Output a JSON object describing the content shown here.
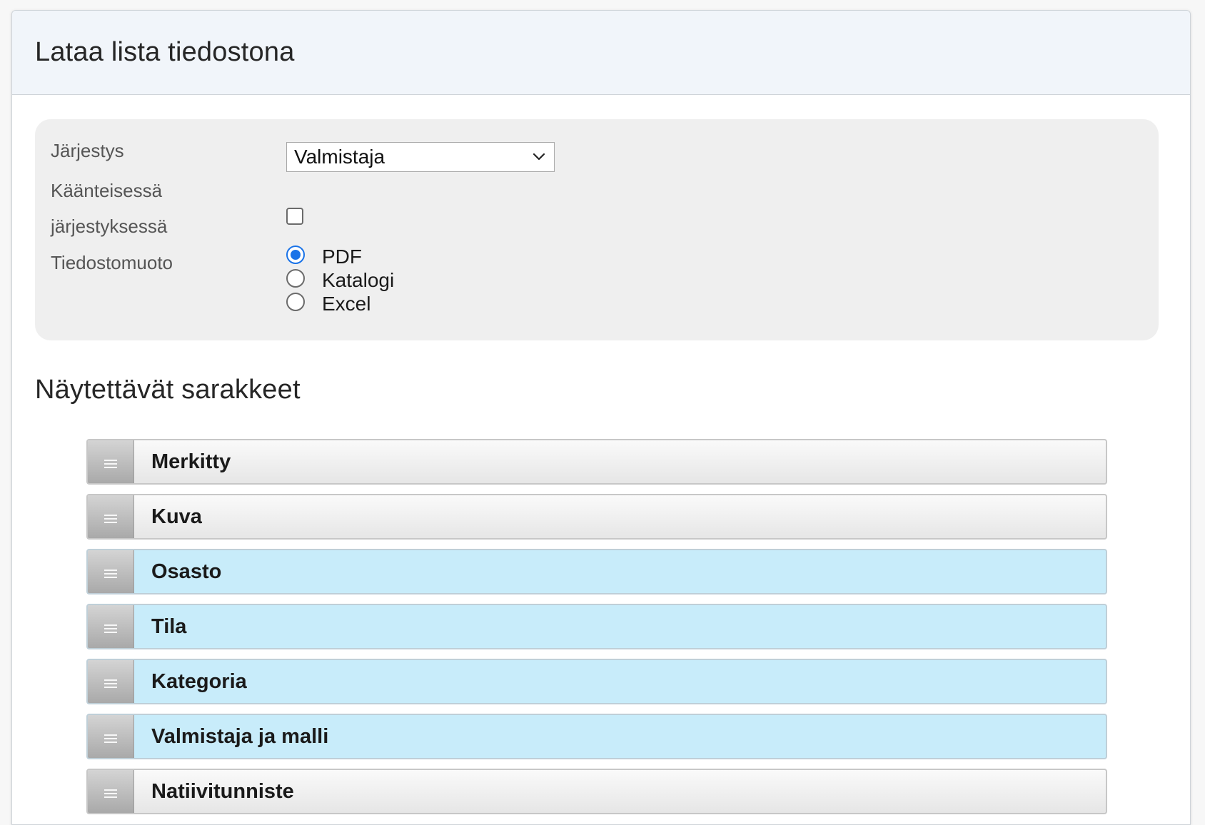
{
  "header": {
    "title": "Lataa lista tiedostona"
  },
  "options": {
    "sort_label": "Järjestys",
    "sort_value": "Valmistaja",
    "reverse_label_line1": "Käänteisessä",
    "reverse_label_line2": "järjestyksessä",
    "reverse_checked": false,
    "format_label": "Tiedostomuoto",
    "formats": [
      {
        "label": "PDF",
        "selected": true
      },
      {
        "label": "Katalogi",
        "selected": false
      },
      {
        "label": "Excel",
        "selected": false
      }
    ]
  },
  "columns_section": {
    "title": "Näytettävät sarakkeet",
    "items": [
      {
        "label": "Merkitty",
        "active": false
      },
      {
        "label": "Kuva",
        "active": false
      },
      {
        "label": "Osasto",
        "active": true
      },
      {
        "label": "Tila",
        "active": true
      },
      {
        "label": "Kategoria",
        "active": true
      },
      {
        "label": "Valmistaja ja malli",
        "active": true
      },
      {
        "label": "Natiivitunniste",
        "active": false
      }
    ]
  },
  "colors": {
    "active_row": "#c8ecfa",
    "radio_accent": "#1a73e8",
    "header_bg": "#f1f5fa",
    "options_bg": "#efefef"
  },
  "icons": {
    "select": "chevron-down-icon",
    "handle": "drag-handle-icon"
  }
}
